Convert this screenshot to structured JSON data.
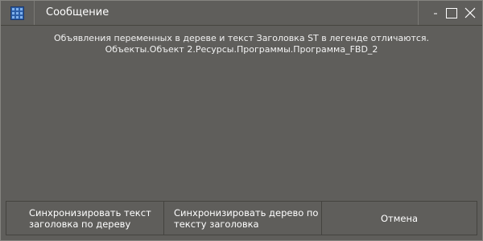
{
  "window": {
    "title": "Сообщение",
    "icon": "grid-app-icon",
    "controls": {
      "minimize_icon": "minimize-icon",
      "maximize_icon": "maximize-icon",
      "close_icon": "close-icon"
    }
  },
  "message": {
    "line1": "Объявления переменных в дереве и текст Заголовка ST в легенде отличаются.",
    "line2": "Объекты.Объект 2.Ресурсы.Программы.Программа_FBD_2"
  },
  "buttons": {
    "sync_text_to_tree": "Синхронизировать текст\nзаголовка по дереву",
    "sync_tree_to_text": "Синхронизировать дерево по\nтексту заголовка",
    "cancel": "Отмена"
  },
  "colors": {
    "background": "#5f5e5b",
    "border": "#858480",
    "text": "#ffffff",
    "icon_blue": "#3a6fb5"
  }
}
